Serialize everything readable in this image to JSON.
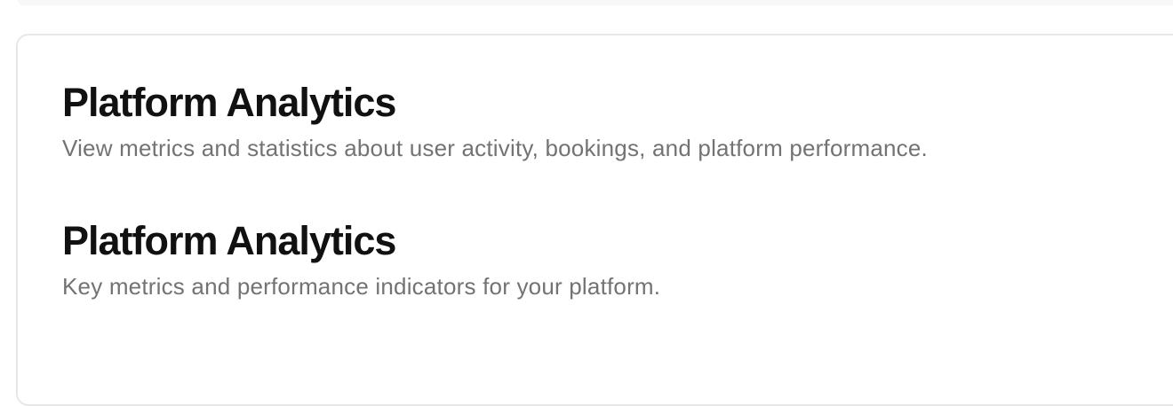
{
  "sections": [
    {
      "title": "Platform Analytics",
      "subtitle": "View metrics and statistics about user activity, bookings, and platform performance."
    },
    {
      "title": "Platform Analytics",
      "subtitle": "Key metrics and performance indicators for your platform."
    }
  ]
}
